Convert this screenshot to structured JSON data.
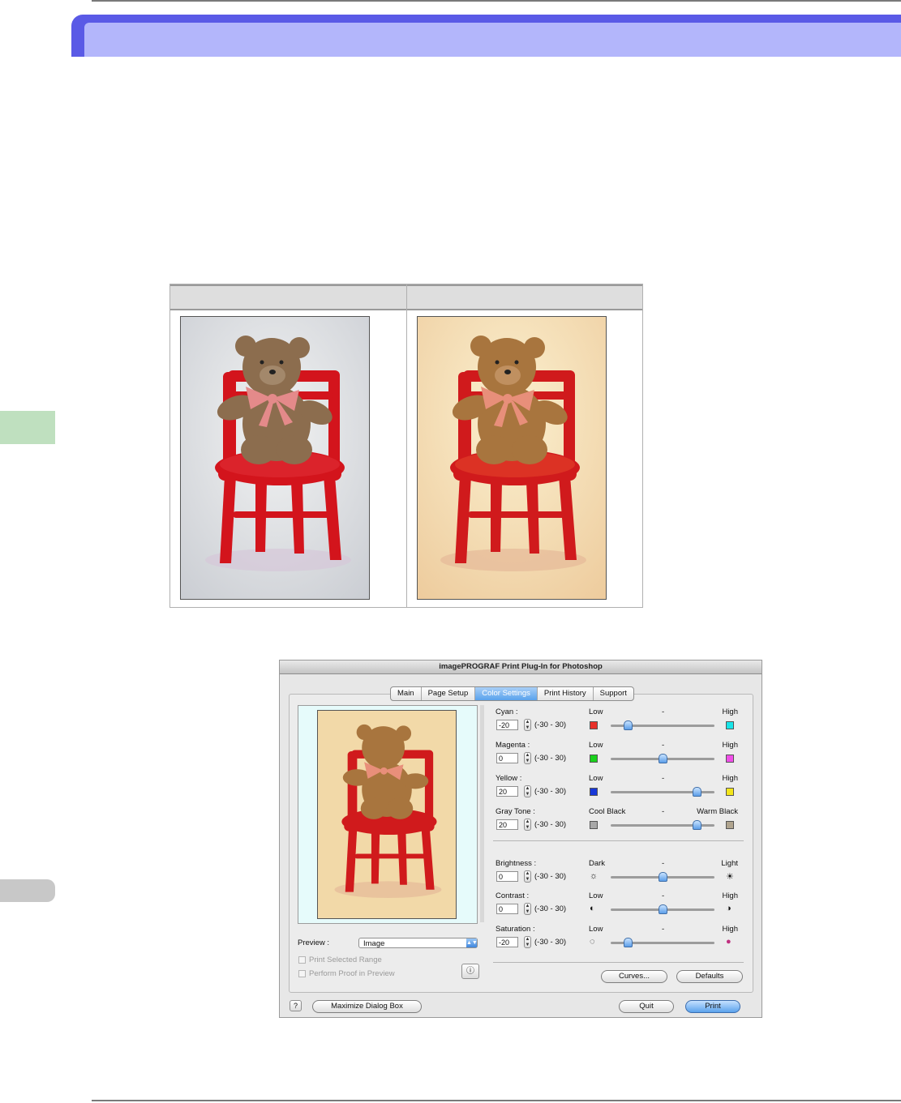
{
  "dialog": {
    "title": "imagePROGRAF Print Plug-In for Photoshop",
    "tabs": [
      "Main",
      "Page Setup",
      "Color Settings",
      "Print History",
      "Support"
    ],
    "active_tab": "Color Settings",
    "preview": {
      "label": "Preview :",
      "selected": "Image",
      "print_selected_range": "Print Selected Range",
      "perform_proof": "Perform Proof in Preview"
    },
    "range_text": "(-30 - 30)",
    "adjust_group_1": [
      {
        "name": "Cyan :",
        "value": "-20",
        "low": "Low",
        "mid": "-",
        "high": "High",
        "low_color": "#e8302a",
        "high_color": "#18e4e8",
        "level": -20
      },
      {
        "name": "Magenta :",
        "value": "0",
        "low": "Low",
        "mid": "-",
        "high": "High",
        "low_color": "#19d11b",
        "high_color": "#f04ee8",
        "level": 0
      },
      {
        "name": "Yellow :",
        "value": "20",
        "low": "Low",
        "mid": "-",
        "high": "High",
        "low_color": "#1838d8",
        "high_color": "#f3e51a",
        "level": 20
      },
      {
        "name": "Gray Tone :",
        "value": "20",
        "low": "Cool Black",
        "mid": "-",
        "high": "Warm Black",
        "low_color": "#a8a8a8",
        "high_color": "#b0a48e",
        "level": 20
      }
    ],
    "adjust_group_2": [
      {
        "name": "Brightness :",
        "value": "0",
        "low": "Dark",
        "mid": "-",
        "high": "Light",
        "low_icon": "sun-dim-icon",
        "high_icon": "sun-bright-icon",
        "level": 0
      },
      {
        "name": "Contrast :",
        "value": "0",
        "low": "Low",
        "mid": "-",
        "high": "High",
        "low_icon": "contrast-low-icon",
        "high_icon": "contrast-high-icon",
        "level": 0
      },
      {
        "name": "Saturation :",
        "value": "-20",
        "low": "Low",
        "mid": "-",
        "high": "High",
        "low_icon": "saturation-low-icon",
        "high_icon": "saturation-high-icon",
        "level": -20
      }
    ],
    "buttons": {
      "curves": "Curves...",
      "defaults": "Defaults",
      "maximize": "Maximize Dialog Box",
      "quit": "Quit",
      "print": "Print"
    }
  },
  "colors": {
    "banner": "#5a5ae6",
    "banner_light": "#b3b6fb",
    "accent_tab": "#bfe0bf",
    "chair_red": "#d4121c",
    "bear_brown": "#8c6d4e"
  }
}
